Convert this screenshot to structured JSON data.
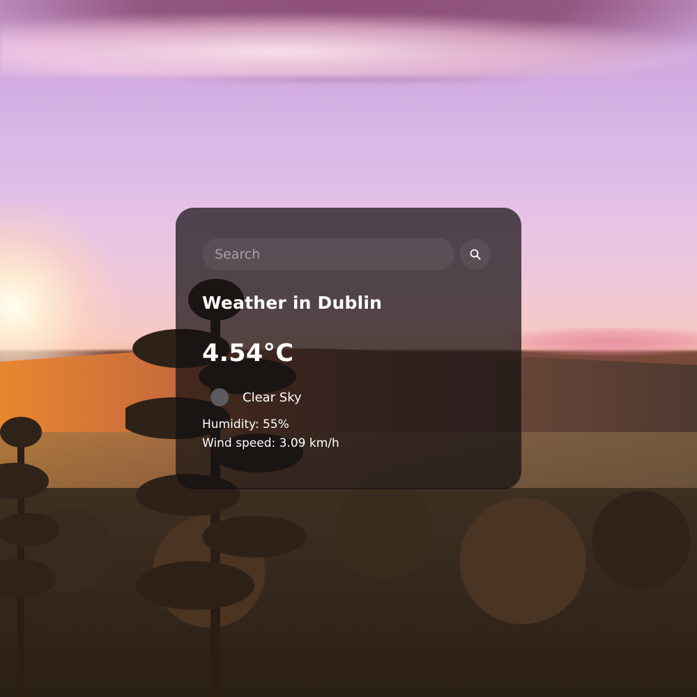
{
  "search": {
    "placeholder": "Search",
    "value": ""
  },
  "weather": {
    "title": "Weather in Dublin",
    "temperature": "4.54°C",
    "condition": "Clear Sky",
    "humidity": "Humidity: 55%",
    "wind": "Wind speed: 3.09 km/h"
  },
  "icons": {
    "search_button": "search-icon",
    "condition": "weather-condition-icon"
  },
  "colors": {
    "card_background": "#141012",
    "text": "#ffffff",
    "input_background": "#6e6468",
    "condition_icon": "#5d5a5f"
  }
}
